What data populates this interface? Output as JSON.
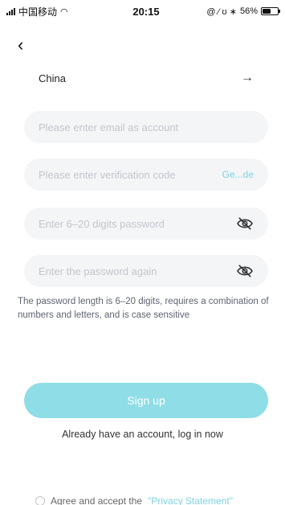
{
  "status_bar": {
    "carrier": "中国移动",
    "wifi_icon": "wifi-icon",
    "time": "20:15",
    "status_icons": "@ ⁄ ʊ ∗",
    "battery_percent": "56%",
    "battery_level": 0.56
  },
  "nav": {
    "back_icon": "chevron-left-icon"
  },
  "form": {
    "country_value": "China",
    "email_placeholder": "Please enter email as account",
    "code_placeholder": "Please enter verification code",
    "get_code_label": "Ge...de",
    "password_placeholder": "Enter 6–20 digits password",
    "password_again_placeholder": "Enter the password again",
    "hint": "The password length is 6–20 digits, requires a combination of numbers and letters, and is case sensitive"
  },
  "actions": {
    "signup_label": "Sign up",
    "login_link": "Already have an account, log in now"
  },
  "agreement": {
    "text": "Agree and accept the",
    "privacy_link": "\"Privacy Statement\""
  },
  "colors": {
    "accent": "#8fdde6",
    "link": "#7fd3e0",
    "field_bg": "#f4f5f7"
  }
}
